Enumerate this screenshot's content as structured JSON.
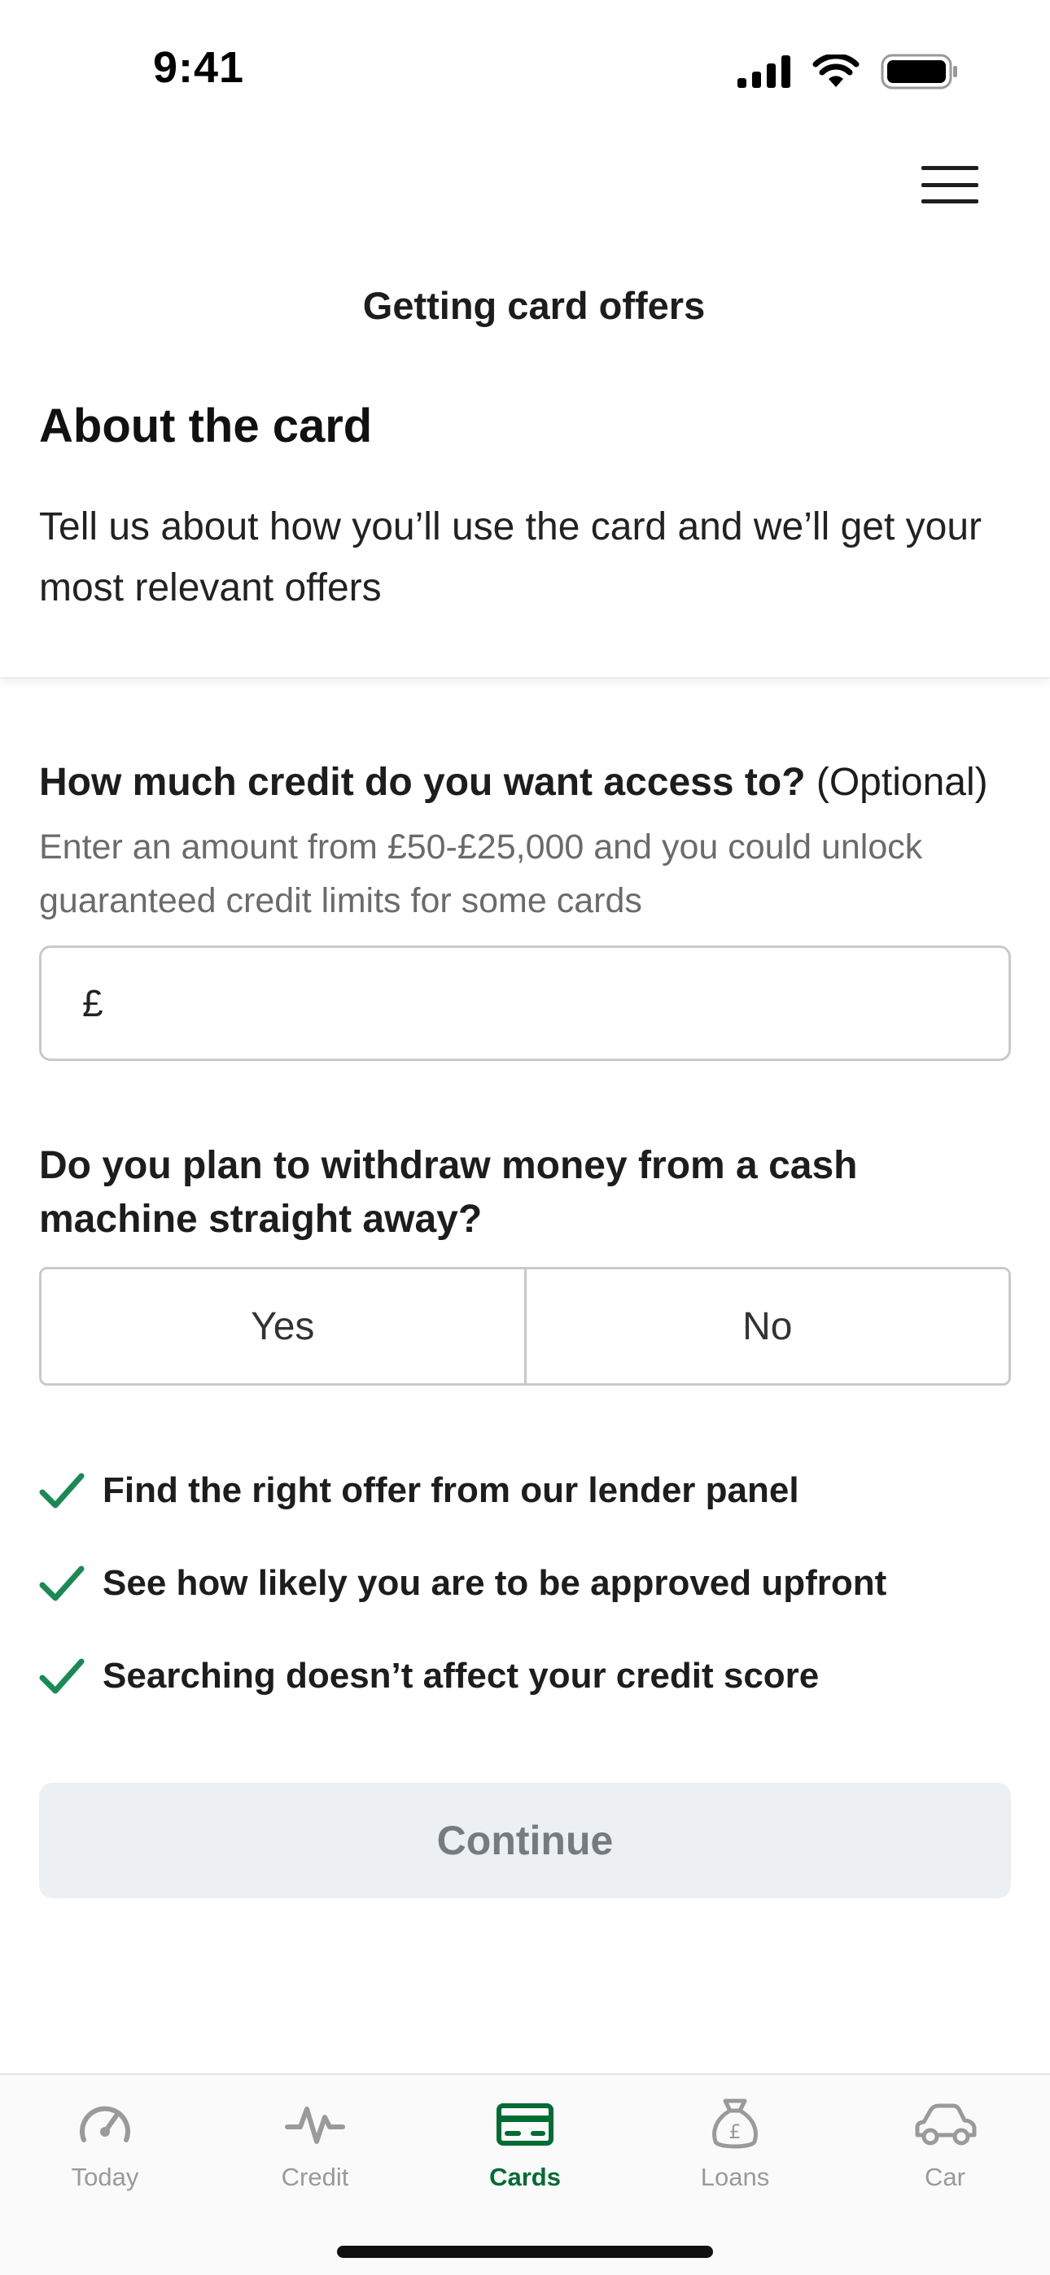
{
  "status_bar": {
    "time": "9:41",
    "icons": [
      "signal-icon",
      "wifi-icon",
      "battery-icon"
    ]
  },
  "header": {
    "menu_icon": "hamburger-menu-icon",
    "title": "Getting card offers"
  },
  "intro": {
    "heading": "About the card",
    "text": "Tell us about how you’ll use the card and we’ll get your most relevant offers"
  },
  "form": {
    "credit_question": "How much credit do you want access to?",
    "credit_optional": "(Optional)",
    "credit_help": "Enter an amount from £50-£25,000 and you could unlock guaranteed credit limits for some cards",
    "currency_symbol": "£",
    "amount_value": "",
    "cash_question": "Do you plan to withdraw money from a cash machine straight away?",
    "options": [
      "Yes",
      "No"
    ],
    "selected_option": null
  },
  "benefits": [
    "Find the right offer from our lender panel",
    "See how likely you are to be approved upfront",
    "Searching doesn’t affect your credit score"
  ],
  "continue_label": "Continue",
  "continue_enabled": false,
  "tab_bar": {
    "tabs": [
      {
        "label": "Today",
        "icon": "gauge-icon"
      },
      {
        "label": "Credit",
        "icon": "pulse-icon"
      },
      {
        "label": "Cards",
        "icon": "card-icon"
      },
      {
        "label": "Loans",
        "icon": "money-bag-icon"
      },
      {
        "label": "Car",
        "icon": "car-icon"
      }
    ],
    "active": "Cards"
  },
  "colors": {
    "accent_green": "#006b33",
    "check_green": "#1a8a55",
    "inactive_tab": "#9a9a9a",
    "disabled_button_bg": "#edf0f2",
    "disabled_button_text": "#757b7e"
  }
}
